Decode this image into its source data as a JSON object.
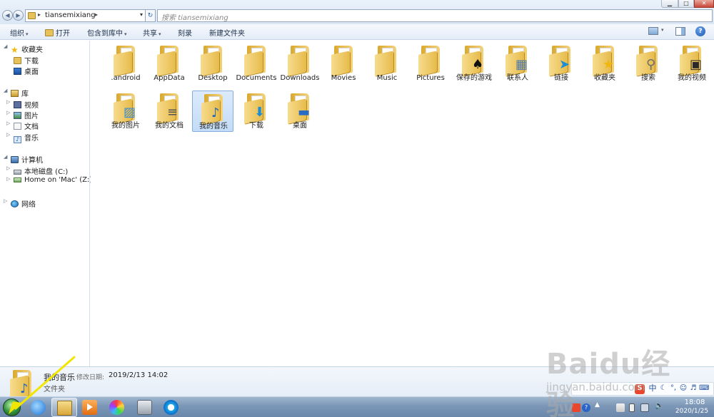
{
  "address": {
    "path": "tiansemixiang",
    "search_placeholder": "搜索 tiansemixiang"
  },
  "toolbar": {
    "organize": "组织",
    "open": "打开",
    "include_in_library": "包含到库中",
    "share": "共享",
    "burn": "刻录",
    "new_folder": "新建文件夹"
  },
  "nav": {
    "favorites": "收藏夹",
    "downloads": "下载",
    "desktop": "桌面",
    "libraries": "库",
    "videos": "视频",
    "pictures": "图片",
    "documents": "文档",
    "music": "音乐",
    "computer": "计算机",
    "local_disk": "本地磁盘 (C:)",
    "home_mac": "Home on 'Mac' (Z:)",
    "network": "网络"
  },
  "items": [
    {
      "label": ".android",
      "badge": ""
    },
    {
      "label": "AppData",
      "badge": ""
    },
    {
      "label": "Desktop",
      "badge": ""
    },
    {
      "label": "Documents",
      "badge": ""
    },
    {
      "label": "Downloads",
      "badge": ""
    },
    {
      "label": "Movies",
      "badge": ""
    },
    {
      "label": "Music",
      "badge": ""
    },
    {
      "label": "Pictures",
      "badge": ""
    },
    {
      "label": "保存的游戏",
      "badge": "♠"
    },
    {
      "label": "联系人",
      "badge": "▦"
    },
    {
      "label": "链接",
      "badge": "➤"
    },
    {
      "label": "收藏夹",
      "badge": "★"
    },
    {
      "label": "搜索",
      "badge": "⚲"
    },
    {
      "label": "我的视频",
      "badge": "▣"
    },
    {
      "label": "我的图片",
      "badge": "▨"
    },
    {
      "label": "我的文档",
      "badge": "≡"
    },
    {
      "label": "我的音乐",
      "badge": "♪",
      "selected": true
    },
    {
      "label": "下载",
      "badge": "⬇"
    },
    {
      "label": "桌面",
      "badge": "▬"
    }
  ],
  "details": {
    "name": "我的音乐",
    "modified_label": "修改日期:",
    "modified_value": "2019/2/13 14:02",
    "type": "文件夹"
  },
  "taskbar": {
    "time": "18:08",
    "date": "2020/1/25",
    "ime_lang": "中"
  },
  "watermark": {
    "brand": "Baidu经验",
    "url": "jingyan.baidu.com"
  },
  "colors": {
    "annotation_arrow": "#f2e600",
    "selection": "#cde3f9"
  }
}
